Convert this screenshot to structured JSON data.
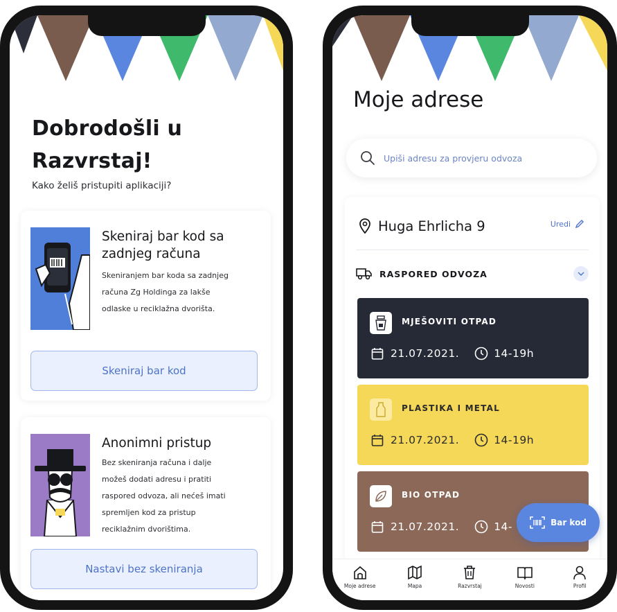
{
  "colors": {
    "navy": "#262a37",
    "yellow": "#f6d858",
    "brown": "#8b6858",
    "blue": "#5a86e0",
    "green": "#3fb96b",
    "accent_text": "#4d73c8"
  },
  "left_screen": {
    "title_line1": "Dobrodošli u",
    "title_line2": "Razvrstaj!",
    "subtitle": "Kako želiš pristupiti aplikaciji?",
    "options": [
      {
        "illustration": "phone-scanning-barcode",
        "title_line1": "Skeniraj bar kod sa",
        "title_line2": "zadnjeg računa",
        "desc_lines": [
          "Skeniranjem bar koda sa zadnjeg",
          "računa Zg Holdinga za lakše",
          "odlaske u reciklažna dvorišta."
        ],
        "button_label": "Skeniraj bar kod"
      },
      {
        "illustration": "anonymous-character",
        "title_line1": "Anonimni pristup",
        "desc_lines": [
          "Bez skeniranja računa i dalje",
          "možeš dodati adresu i pratiti",
          "raspored odvoza, ali nećeš imati",
          "spremljen kod za pristup",
          "reciklažnim dvorištima."
        ],
        "button_label": "Nastavi bez skeniranja"
      }
    ]
  },
  "right_screen": {
    "title": "Moje adrese",
    "search": {
      "icon": "search-icon",
      "placeholder": "Upiši adresu za provjeru odvoza"
    },
    "address": {
      "icon": "map-pin-icon",
      "name": "Huga Ehrlicha 9",
      "edit_label": "Uredi",
      "schedule_label": "RASPORED ODVOZA",
      "pickups": [
        {
          "type": "MJEŠOVITI OTPAD",
          "icon": "mixed-waste-icon",
          "date": "21.07.2021.",
          "time": "14-19h"
        },
        {
          "type": "PLASTIKA I METAL",
          "icon": "plastic-icon",
          "date": "21.07.2021.",
          "time": "14-19h"
        },
        {
          "type": "BIO OTPAD",
          "icon": "leaf-icon",
          "date": "21.07.2021.",
          "time": "14-"
        }
      ]
    },
    "fab_label": "Bar kod",
    "tabs": [
      {
        "label": "Moje adrese",
        "icon": "home-icon"
      },
      {
        "label": "Mapa",
        "icon": "map-icon"
      },
      {
        "label": "Razvrstaj",
        "icon": "trash-icon"
      },
      {
        "label": "Novosti",
        "icon": "book-icon"
      },
      {
        "label": "Profil",
        "icon": "user-icon"
      }
    ]
  }
}
